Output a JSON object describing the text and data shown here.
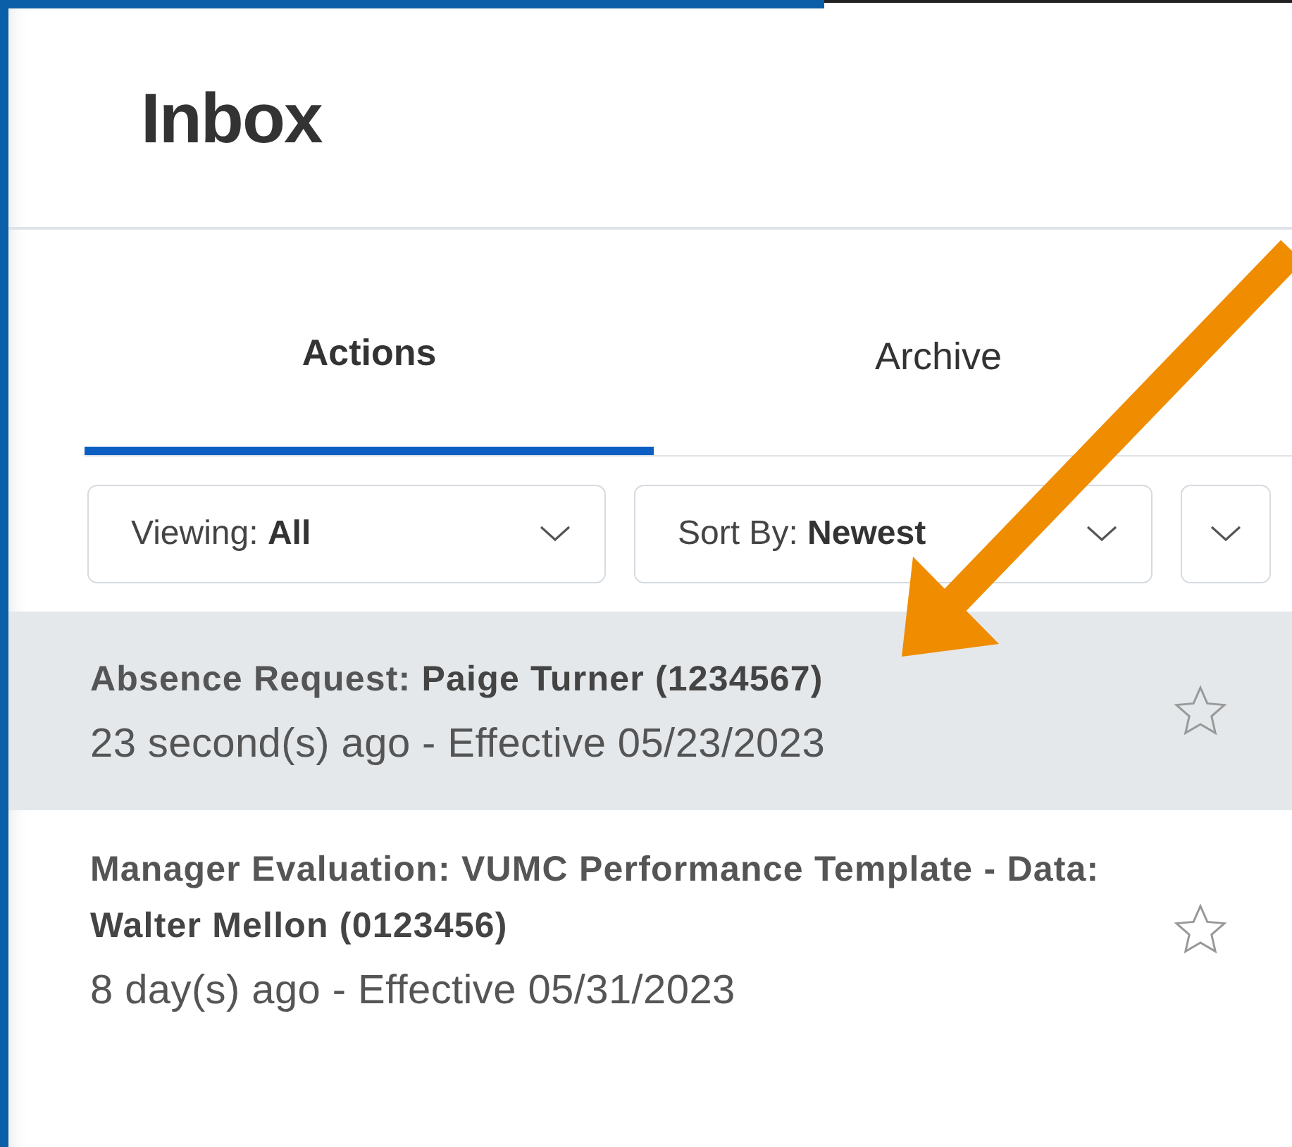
{
  "header": {
    "title": "Inbox"
  },
  "tabs": [
    {
      "label": "Actions",
      "selected": true
    },
    {
      "label": "Archive",
      "selected": false
    }
  ],
  "filters": [
    {
      "label": "Viewing:",
      "value": "All"
    },
    {
      "label": "Sort By:",
      "value": "Newest"
    }
  ],
  "items": [
    {
      "title": "Absence Request: **Paige Turner (1234567)**",
      "meta": "23 second(s) ago - Effective 05/23/2023",
      "selected": true,
      "starred": false
    },
    {
      "title": "Manager Evaluation: VUMC Performance Template - Data: **Walter Mellon (0123456)**",
      "meta": "8 day(s) ago - Effective 05/31/2023",
      "selected": false,
      "starred": false
    }
  ]
}
